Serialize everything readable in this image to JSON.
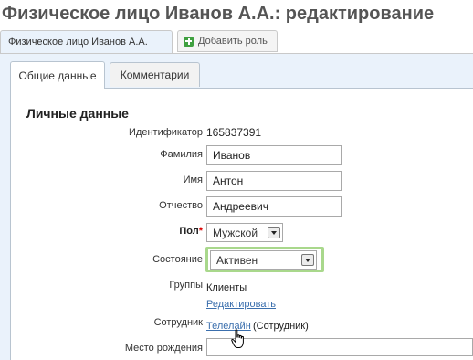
{
  "title": "Физическое лицо Иванов А.А.: редактирование",
  "top_tabs": {
    "active": "Физическое лицо Иванов А.А.",
    "add_role": "Добавить роль"
  },
  "inner_tabs": [
    "Общие данные",
    "Комментарии"
  ],
  "section": "Личные данные",
  "fields": {
    "id_label": "Идентификатор",
    "id_value": "165837391",
    "lastname_label": "Фамилия",
    "lastname_value": "Иванов",
    "firstname_label": "Имя",
    "firstname_value": "Антон",
    "patronymic_label": "Отчество",
    "patronymic_value": "Андреевич",
    "gender_label": "Пол",
    "gender_required": "*",
    "gender_value": "Мужской",
    "state_label": "Состояние",
    "state_value": "Активен",
    "groups_label": "Группы",
    "groups_value": "Клиенты",
    "groups_edit": "Редактировать",
    "employee_label": "Сотрудник",
    "employee_link": "Телелайн",
    "employee_suffix": "(Сотрудник)",
    "birthplace_label": "Место рождения",
    "birthplace_value": ""
  },
  "icons": {
    "add_role": "plus-icon",
    "dropdown": "chevron-down-icon",
    "cursor": "hand-pointer-icon"
  },
  "colors": {
    "panel": "#eaf2fb",
    "link": "#3b6fad",
    "state_highlight": "#a9d88c",
    "required": "#dd0000"
  }
}
